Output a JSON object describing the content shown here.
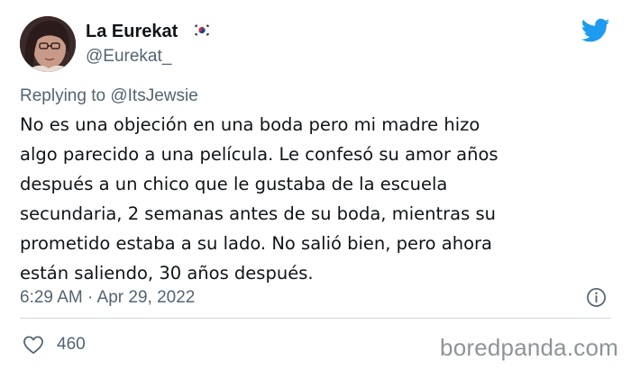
{
  "tweet": {
    "display_name": "La Eurekat",
    "handle": "@Eurekat_",
    "replying_prefix": "Replying to ",
    "replying_mention": "@ItsJewsie",
    "text": "No es una objeción en una boda pero mi madre hizo\nalgo parecido a una película. Le confesó su amor años\ndespués a un chico que le gustaba de la escuela\nsecundaria, 2 semanas antes de su boda, mientras su\nprometido estaba a su lado. No salió bien, pero ahora\nestán saliendo, 30 años después.",
    "timestamp": "6:29 AM · Apr 29, 2022",
    "like_count": "460"
  },
  "icons": {
    "avatar": "user-avatar-photo",
    "flag": "south-korea-flag-icon",
    "bird": "twitter-bird-icon",
    "info": "info-icon",
    "like": "heart-icon"
  },
  "colors": {
    "twitter_blue": "#1d9bf0",
    "text_primary": "#0f1419",
    "text_secondary": "#536471",
    "divider": "#cfd9de",
    "watermark": "#8e9499"
  },
  "watermark": "boredpanda.com"
}
